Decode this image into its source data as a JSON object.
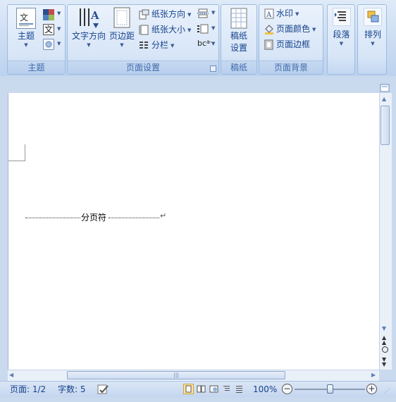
{
  "ribbon": {
    "themes": {
      "themes_label": "主题",
      "group_label": "主题"
    },
    "page_setup": {
      "text_direction": "文字方向",
      "margins": "页边距",
      "orientation": "纸张方向",
      "size": "纸张大小",
      "columns": "分栏",
      "group_label": "页面设置"
    },
    "manuscript": {
      "setup_line1": "稿纸",
      "setup_line2": "设置",
      "group_label": "稿纸"
    },
    "page_background": {
      "watermark": "水印",
      "page_color": "页面颜色",
      "page_borders": "页面边框",
      "group_label": "页面背景"
    },
    "paragraph": {
      "label": "段落"
    },
    "arrange": {
      "label": "排列"
    }
  },
  "document": {
    "page_break_text": "分页符",
    "paragraph_mark": "↵"
  },
  "status_bar": {
    "page": "页面: 1/2",
    "words": "字数: 5",
    "zoom": "100%"
  },
  "zoom_slider_level": 0.5,
  "colors": {
    "accent": "#15428b",
    "ribbon_bg": "#d7e5f7",
    "workspace": "#c9d9ee"
  }
}
